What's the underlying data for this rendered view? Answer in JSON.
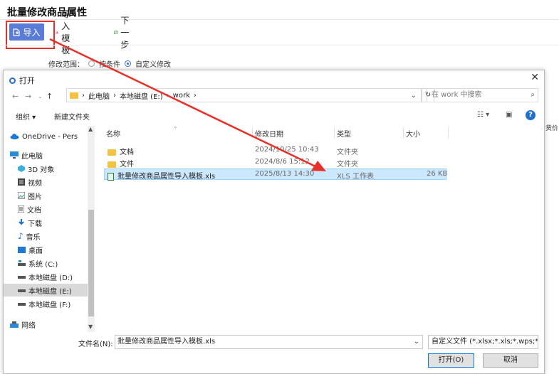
{
  "app": {
    "title": "批量修改商品属性",
    "toolbar": {
      "import_label": "导入",
      "template_label": "导入模板",
      "next_label": "下一步"
    },
    "scope": {
      "label": "修改范围：",
      "option1": "按条件",
      "option2": "自定义修改"
    },
    "right_text": "货价"
  },
  "dialog": {
    "title": "打开",
    "close": "✕",
    "address": [
      "此电脑",
      "本地磁盘 (E:)",
      "work"
    ],
    "search_placeholder": "在 work 中搜索",
    "organize": "组织 ▾",
    "new_folder": "新建文件夹",
    "nav": [
      {
        "label": "OneDrive - Pers",
        "icon": "cloud-icon"
      },
      {
        "label": "此电脑",
        "icon": "computer-icon"
      },
      {
        "label": "3D 对象",
        "icon": "cube-icon"
      },
      {
        "label": "视频",
        "icon": "video-icon"
      },
      {
        "label": "图片",
        "icon": "image-icon"
      },
      {
        "label": "文档",
        "icon": "document-icon"
      },
      {
        "label": "下载",
        "icon": "download-icon"
      },
      {
        "label": "音乐",
        "icon": "music-icon"
      },
      {
        "label": "桌面",
        "icon": "desktop-icon"
      },
      {
        "label": "系统 (C:)",
        "icon": "drive-icon"
      },
      {
        "label": "本地磁盘 (D:)",
        "icon": "drive-icon"
      },
      {
        "label": "本地磁盘 (E:)",
        "icon": "drive-icon"
      },
      {
        "label": "本地磁盘 (F:)",
        "icon": "drive-icon"
      },
      {
        "label": "网络",
        "icon": "network-icon"
      }
    ],
    "columns": {
      "name": "名称",
      "date": "修改日期",
      "type": "类型",
      "size": "大小"
    },
    "files": [
      {
        "name": "文档",
        "date": "2024/10/25 10:43",
        "type": "文件夹",
        "size": ""
      },
      {
        "name": "文件",
        "date": "2024/8/6 15:12",
        "type": "文件夹",
        "size": ""
      },
      {
        "name": "批量修改商品属性导入模板.xls",
        "date": "2025/8/13 14:30",
        "type": "XLS 工作表",
        "size": "26 KB"
      }
    ],
    "filename_label": "文件名(N):",
    "filename_value": "批量修改商品属性导入模板.xls",
    "filter": "自定义文件 (*.xlsx;*.xls;*.wps;*",
    "open_button": "打开(O)",
    "cancel_button": "取消"
  },
  "colors": {
    "accent": "#5b7cd6",
    "highlight": "#e8302a",
    "selection": "#cce8ff"
  }
}
